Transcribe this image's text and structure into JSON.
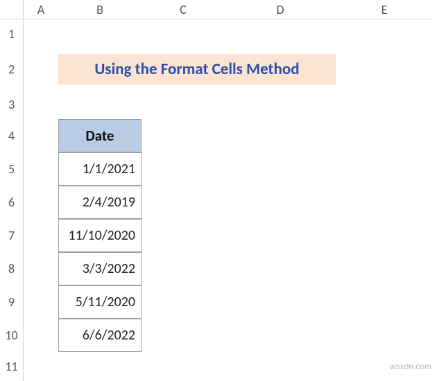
{
  "columns": [
    "",
    "A",
    "B",
    "C",
    "D",
    "E"
  ],
  "rows": [
    "1",
    "2",
    "3",
    "4",
    "5",
    "6",
    "7",
    "8",
    "9",
    "10",
    "11"
  ],
  "title": "Using the Format Cells Method",
  "table": {
    "header": "Date",
    "values": [
      "1/1/2021",
      "2/4/2019",
      "11/10/2020",
      "3/3/2022",
      "5/11/2020",
      "6/6/2022"
    ]
  },
  "watermark": "wsxdn.com",
  "chart_data": {
    "type": "table",
    "title": "Using the Format Cells Method",
    "columns": [
      "Date"
    ],
    "rows": [
      [
        "1/1/2021"
      ],
      [
        "2/4/2019"
      ],
      [
        "11/10/2020"
      ],
      [
        "3/3/2022"
      ],
      [
        "5/11/2020"
      ],
      [
        "6/6/2022"
      ]
    ]
  }
}
